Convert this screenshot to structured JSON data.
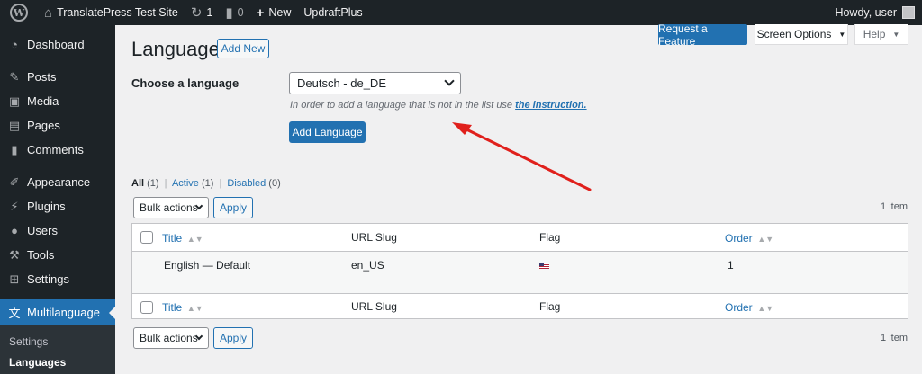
{
  "adminbar": {
    "site_name": "TranslatePress Test Site",
    "updates_count": "1",
    "comments_count": "0",
    "new_label": "New",
    "plugin_label": "UpdraftPlus",
    "howdy": "Howdy, user"
  },
  "sidebar": {
    "items": [
      {
        "label": "Dashboard",
        "icon": "dashboard-icon"
      },
      {
        "label": "Posts",
        "icon": "pin-icon"
      },
      {
        "label": "Media",
        "icon": "media-icon"
      },
      {
        "label": "Pages",
        "icon": "pages-icon"
      },
      {
        "label": "Comments",
        "icon": "comment-icon"
      },
      {
        "label": "Appearance",
        "icon": "brush-icon"
      },
      {
        "label": "Plugins",
        "icon": "plug-icon"
      },
      {
        "label": "Users",
        "icon": "user-icon"
      },
      {
        "label": "Tools",
        "icon": "wrench-icon"
      },
      {
        "label": "Settings",
        "icon": "settings-icon"
      },
      {
        "label": "Multilanguage",
        "icon": "translate-icon"
      }
    ],
    "submenu": [
      "Settings",
      "Languages"
    ]
  },
  "top_buttons": {
    "request_feature": "Request a Feature",
    "screen_options": "Screen Options",
    "help": "Help"
  },
  "page": {
    "title": "Languages",
    "add_new": "Add New",
    "choose_label": "Choose a language",
    "selected_language": "Deutsch - de_DE",
    "help_text": "In order to add a language that is not in the list use",
    "help_link": "the instruction.",
    "add_language": "Add Language"
  },
  "filters": {
    "all": "All",
    "all_count": "(1)",
    "active": "Active",
    "active_count": "(1)",
    "disabled": "Disabled",
    "disabled_count": "(0)"
  },
  "bulk": {
    "label": "Bulk actions",
    "apply": "Apply",
    "count": "1 item"
  },
  "table": {
    "columns": {
      "title": "Title",
      "slug": "URL Slug",
      "flag": "Flag",
      "order": "Order"
    },
    "rows": [
      {
        "title": "English — Default",
        "slug": "en_US",
        "flag": "us-flag-icon",
        "order": "1"
      }
    ]
  },
  "accent_colors": {
    "primary": "#2271b1",
    "adminbar": "#1d2327",
    "arrow": "#e0201c"
  }
}
